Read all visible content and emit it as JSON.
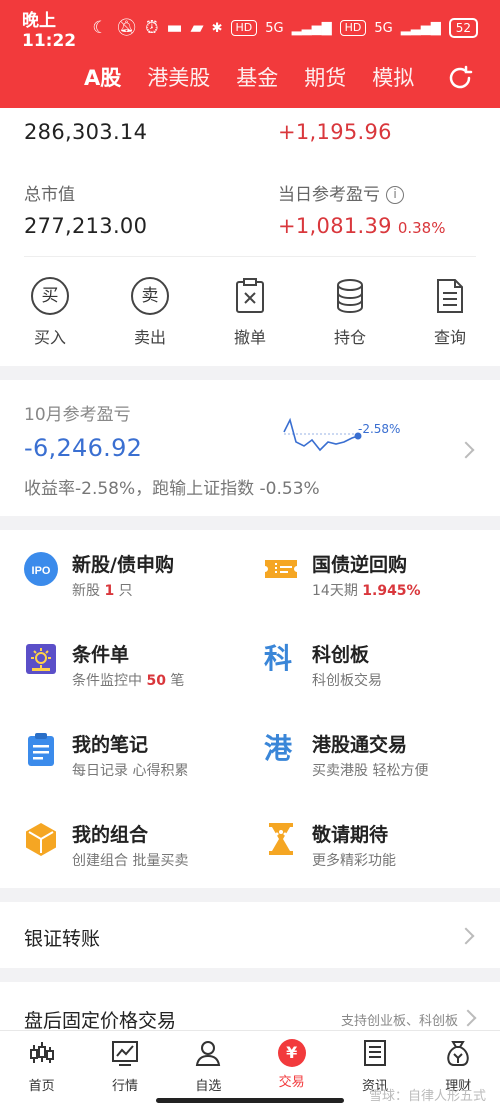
{
  "status_bar": {
    "time": "晚上11:22",
    "hd1": "HD",
    "net1": "5G",
    "hd2": "HD",
    "net2": "5G",
    "battery": "52"
  },
  "header": {
    "tabs": [
      {
        "label": "A股"
      },
      {
        "label": "港美股"
      },
      {
        "label": "基金"
      },
      {
        "label": "期货"
      },
      {
        "label": "模拟"
      }
    ]
  },
  "assets": {
    "top_left_value": "286,303.14",
    "top_right_value": "+1,195.96",
    "market_value_label": "总市值",
    "market_value": "277,213.00",
    "today_pl_label": "当日参考盈亏",
    "today_pl": "+1,081.39",
    "today_pl_pct": "0.38%"
  },
  "actions": [
    {
      "glyph": "买",
      "label": "买入"
    },
    {
      "glyph": "卖",
      "label": "卖出"
    },
    {
      "label": "撤单"
    },
    {
      "label": "持仓"
    },
    {
      "label": "查询"
    }
  ],
  "monthly": {
    "title": "10月参考盈亏",
    "value": "-6,246.92",
    "summary": "收益率-2.58%，跑输上证指数 -0.53%",
    "spark_label": "-2.58%"
  },
  "features": [
    {
      "title": "新股/债申购",
      "sub_pre": "新股 ",
      "sub_num": "1",
      "sub_post": " 只",
      "icon_text": "IPO"
    },
    {
      "title": "国债逆回购",
      "sub_pre": "14天期 ",
      "sub_num": "1.945%",
      "sub_post": ""
    },
    {
      "title": "条件单",
      "sub_pre": "条件监控中 ",
      "sub_num": "50",
      "sub_post": " 笔"
    },
    {
      "title": "科创板",
      "sub_pre": "科创板交易",
      "sub_num": "",
      "sub_post": "",
      "icon_text": "科"
    },
    {
      "title": "我的笔记",
      "sub_pre": "每日记录 心得积累",
      "sub_num": "",
      "sub_post": ""
    },
    {
      "title": "港股通交易",
      "sub_pre": "买卖港股 轻松方便",
      "sub_num": "",
      "sub_post": "",
      "icon_text": "港"
    },
    {
      "title": "我的组合",
      "sub_pre": "创建组合 批量买卖",
      "sub_num": "",
      "sub_post": ""
    },
    {
      "title": "敬请期待",
      "sub_pre": "更多精彩功能",
      "sub_num": "",
      "sub_post": ""
    }
  ],
  "bank_transfer": {
    "label": "银证转账"
  },
  "fixed_price": {
    "label": "盘后固定价格交易",
    "hint": "支持创业板、科创板"
  },
  "nav": [
    {
      "label": "首页"
    },
    {
      "label": "行情"
    },
    {
      "label": "自选"
    },
    {
      "label": "交易",
      "glyph": "¥"
    },
    {
      "label": "资讯"
    },
    {
      "label": "理财"
    }
  ],
  "watermark": "雪球：自律人形五式",
  "colors": {
    "brand_red": "#f23a3c",
    "loss_blue": "#3a6fd1",
    "gain_red": "#d9373c"
  }
}
